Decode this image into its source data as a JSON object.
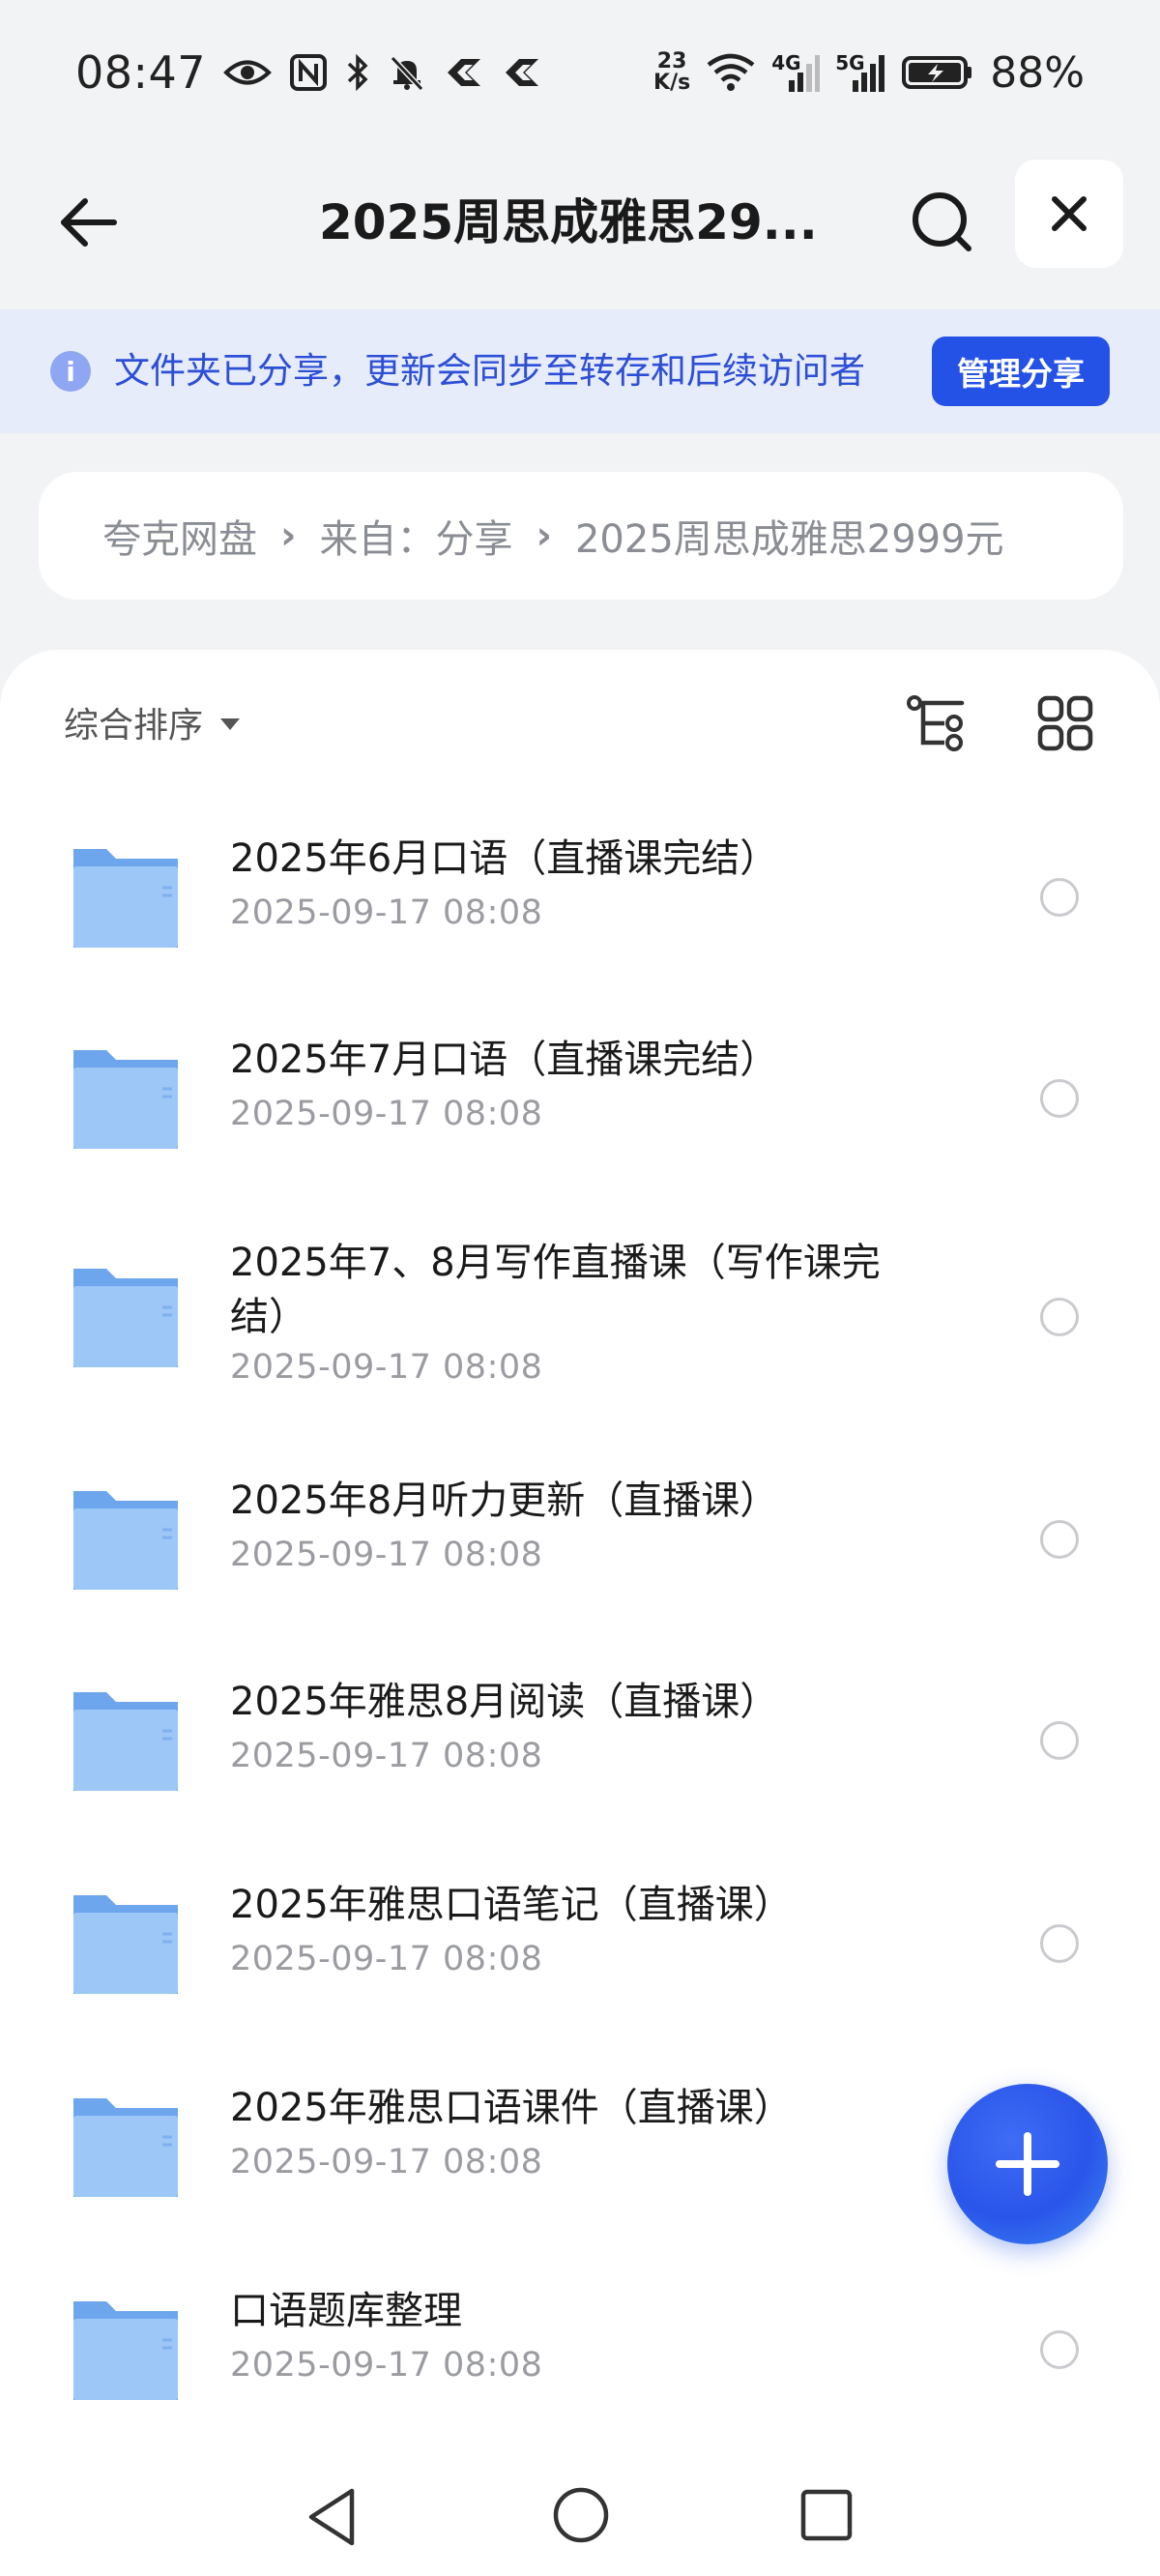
{
  "status_bar": {
    "time": "08:47",
    "net_speed_value": "23",
    "net_speed_unit": "K/s",
    "network_4g": "4G",
    "network_5g": "5G",
    "battery_percent": "88%"
  },
  "header": {
    "title": "2025周思成雅思29..."
  },
  "banner": {
    "info_icon_text": "i",
    "text": "文件夹已分享，更新会同步至转存和后续访问者",
    "button_label": "管理分享"
  },
  "breadcrumb": {
    "items": [
      "夸克网盘",
      "来自：分享",
      "2025周思成雅思2999元"
    ]
  },
  "toolbar": {
    "sort_label": "综合排序"
  },
  "files": [
    {
      "name": "2025年6月口语（直播课完结）",
      "date": "2025-09-17 08:08"
    },
    {
      "name": "2025年7月口语（直播课完结）",
      "date": "2025-09-17 08:08"
    },
    {
      "name": "2025年7、8月写作直播课（写作课完结）",
      "date": "2025-09-17 08:08"
    },
    {
      "name": "2025年8月听力更新（直播课）",
      "date": "2025-09-17 08:08"
    },
    {
      "name": "2025年雅思8月阅读（直播课）",
      "date": "2025-09-17 08:08"
    },
    {
      "name": "2025年雅思口语笔记（直播课）",
      "date": "2025-09-17 08:08"
    },
    {
      "name": "2025年雅思口语课件（直播课）",
      "date": "2025-09-17 08:08"
    },
    {
      "name": "口语题库整理",
      "date": "2025-09-17 08:08"
    }
  ],
  "colors": {
    "accent": "#2451e6",
    "banner_bg": "#e7ecfb",
    "banner_text": "#2d4fd6",
    "folder": "#8dbbf4"
  }
}
